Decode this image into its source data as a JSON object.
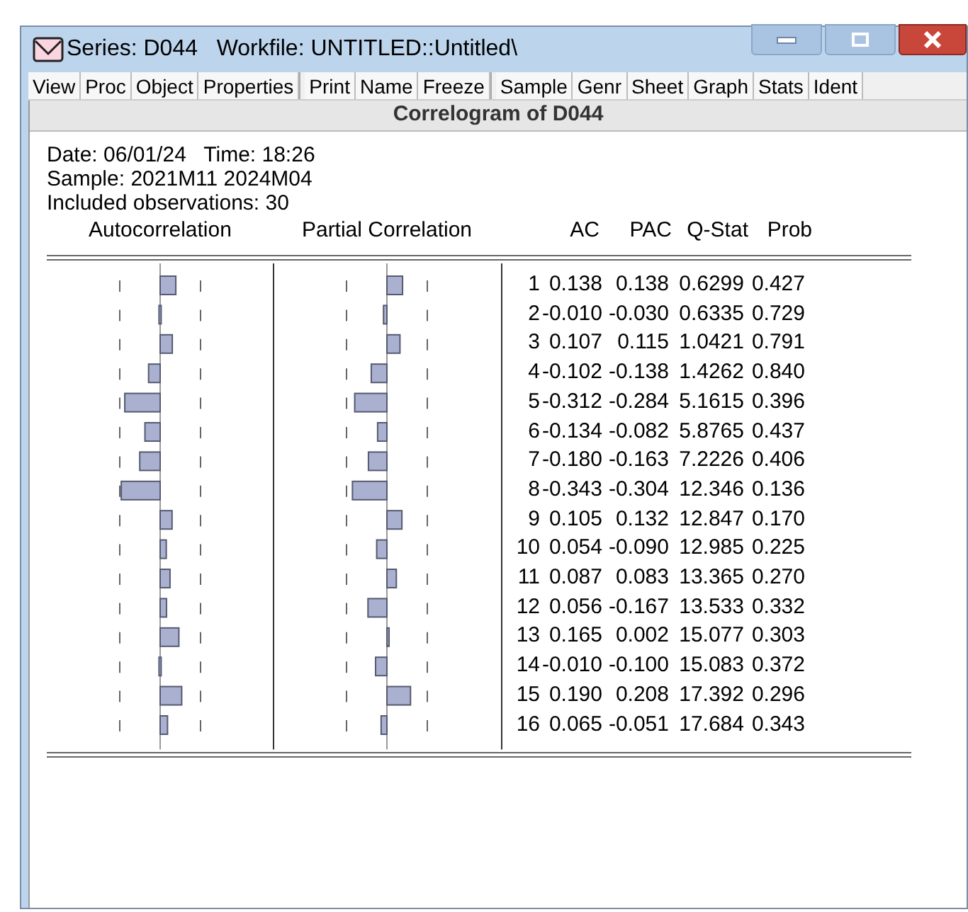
{
  "window": {
    "title": "Series: D044   Workfile: UNTITLED::Untitled\\"
  },
  "toolbar": [
    [
      "View",
      "Proc",
      "Object",
      "Properties"
    ],
    [
      "Print",
      "Name",
      "Freeze"
    ],
    [
      "Sample",
      "Genr",
      "Sheet",
      "Graph",
      "Stats",
      "Ident"
    ]
  ],
  "heading": "Correlogram of D044",
  "info": [
    "Date: 06/01/24   Time: 18:26",
    "Sample: 2021M11 2024M04",
    "Included observations: 30"
  ],
  "columns": [
    "Autocorrelation",
    "Partial Correlation",
    "AC",
    "PAC",
    "Q-Stat",
    "Prob"
  ],
  "rows": [
    {
      "lag": "1",
      "ac": "0.138",
      "pac": "0.138",
      "q_stat": "0.6299",
      "prob": "0.427"
    },
    {
      "lag": "2",
      "ac": "-0.010",
      "pac": "-0.030",
      "q_stat": "0.6335",
      "prob": "0.729"
    },
    {
      "lag": "3",
      "ac": "0.107",
      "pac": "0.115",
      "q_stat": "1.0421",
      "prob": "0.791"
    },
    {
      "lag": "4",
      "ac": "-0.102",
      "pac": "-0.138",
      "q_stat": "1.4262",
      "prob": "0.840"
    },
    {
      "lag": "5",
      "ac": "-0.312",
      "pac": "-0.284",
      "q_stat": "5.1615",
      "prob": "0.396"
    },
    {
      "lag": "6",
      "ac": "-0.134",
      "pac": "-0.082",
      "q_stat": "5.8765",
      "prob": "0.437"
    },
    {
      "lag": "7",
      "ac": "-0.180",
      "pac": "-0.163",
      "q_stat": "7.2226",
      "prob": "0.406"
    },
    {
      "lag": "8",
      "ac": "-0.343",
      "pac": "-0.304",
      "q_stat": "12.346",
      "prob": "0.136"
    },
    {
      "lag": "9",
      "ac": "0.105",
      "pac": "0.132",
      "q_stat": "12.847",
      "prob": "0.170"
    },
    {
      "lag": "10",
      "ac": "0.054",
      "pac": "-0.090",
      "q_stat": "12.985",
      "prob": "0.225"
    },
    {
      "lag": "11",
      "ac": "0.087",
      "pac": "0.083",
      "q_stat": "13.365",
      "prob": "0.270"
    },
    {
      "lag": "12",
      "ac": "0.056",
      "pac": "-0.167",
      "q_stat": "13.533",
      "prob": "0.332"
    },
    {
      "lag": "13",
      "ac": "0.165",
      "pac": "0.002",
      "q_stat": "15.077",
      "prob": "0.303"
    },
    {
      "lag": "14",
      "ac": "-0.010",
      "pac": "-0.100",
      "q_stat": "15.083",
      "prob": "0.372"
    },
    {
      "lag": "15",
      "ac": "0.190",
      "pac": "0.208",
      "q_stat": "17.392",
      "prob": "0.296"
    },
    {
      "lag": "16",
      "ac": "0.065",
      "pac": "-0.051",
      "q_stat": "17.684",
      "prob": "0.343"
    }
  ]
}
